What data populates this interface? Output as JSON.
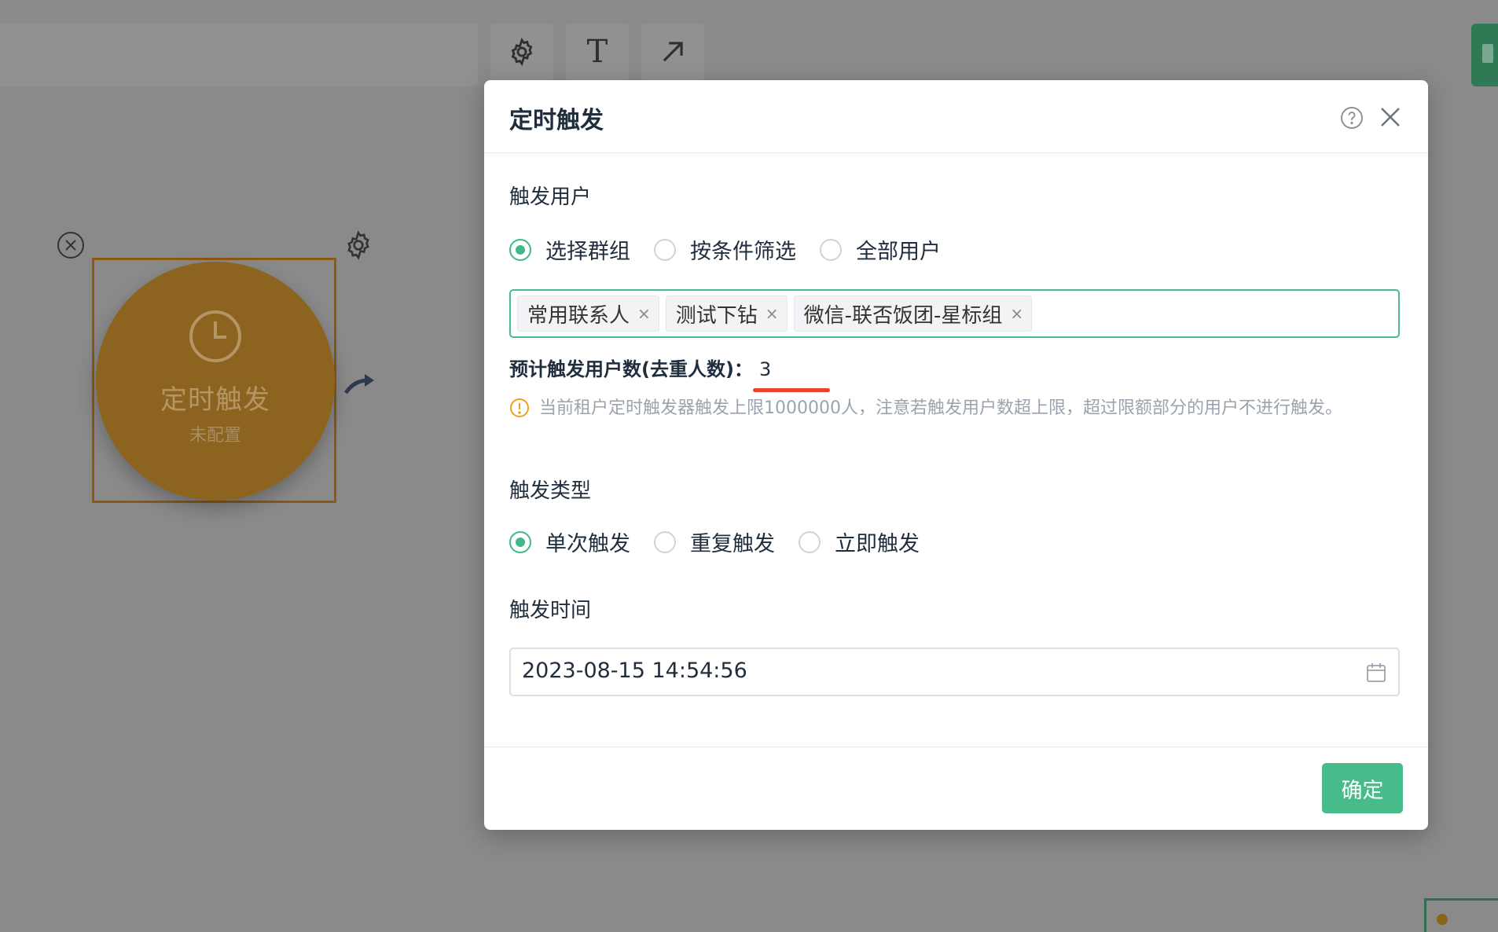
{
  "toolbar": {
    "settings_icon": "gear-icon",
    "text_tool_glyph": "T",
    "arrow_icon": "arrow-up-right-icon"
  },
  "canvas": {
    "node": {
      "title": "定时触发",
      "subtitle": "未配置",
      "color": "#8c6420",
      "icon": "clock-icon"
    }
  },
  "dialog": {
    "title": "定时触发",
    "trigger_users": {
      "label": "触发用户",
      "options": [
        "选择群组",
        "按条件筛选",
        "全部用户"
      ],
      "selected": "选择群组"
    },
    "groups": {
      "tags": [
        "常用联系人",
        "测试下钻",
        "微信-联否饭团-星标组"
      ],
      "remove_glyph": "×"
    },
    "estimate": {
      "label": "预计触发用户数(去重人数)：",
      "value": "3"
    },
    "warning": "当前租户定时触发器触发上限1000000人，注意若触发用户数超上限，超过限额部分的用户不进行触发。",
    "trigger_type": {
      "label": "触发类型",
      "options": [
        "单次触发",
        "重复触发",
        "立即触发"
      ],
      "selected": "单次触发"
    },
    "trigger_time": {
      "label": "触发时间",
      "value": "2023-08-15 14:54:56"
    },
    "confirm_label": "确定",
    "accent_color": "#47bb8a"
  }
}
